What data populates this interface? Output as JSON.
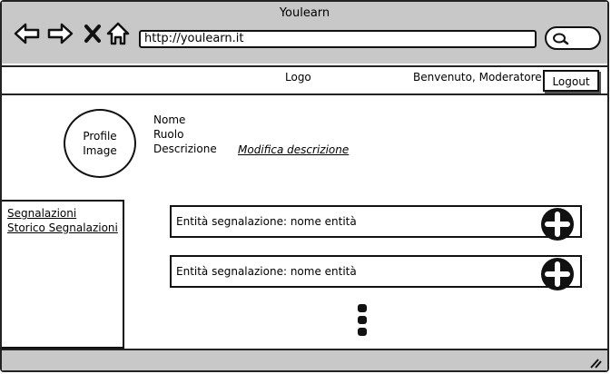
{
  "window": {
    "title": "Youlearn"
  },
  "browser": {
    "url": "http://youlearn.it"
  },
  "header": {
    "logo": "Logo",
    "welcome": "Benvenuto, Moderatore",
    "logout_label": "Logout"
  },
  "profile": {
    "image_label_line1": "Profile",
    "image_label_line2": "Image",
    "name_label": "Nome",
    "role_label": "Ruolo",
    "description_label": "Descrizione",
    "edit_description_link": "Modifica descrizione"
  },
  "sidebar": {
    "items": [
      {
        "label": "Segnalazioni"
      },
      {
        "label": "Storico Segnalazioni"
      }
    ]
  },
  "reports": [
    {
      "label": "Entità segnalazione: nome entità"
    },
    {
      "label": "Entità segnalazione: nome entità"
    }
  ],
  "icons": {
    "back": "arrow-left-icon",
    "forward": "arrow-right-icon",
    "stop": "close-icon",
    "home": "home-icon",
    "search": "search-icon",
    "add": "plus-circle-icon",
    "more": "vertical-dots-icon",
    "resize": "resize-grip-icon"
  }
}
